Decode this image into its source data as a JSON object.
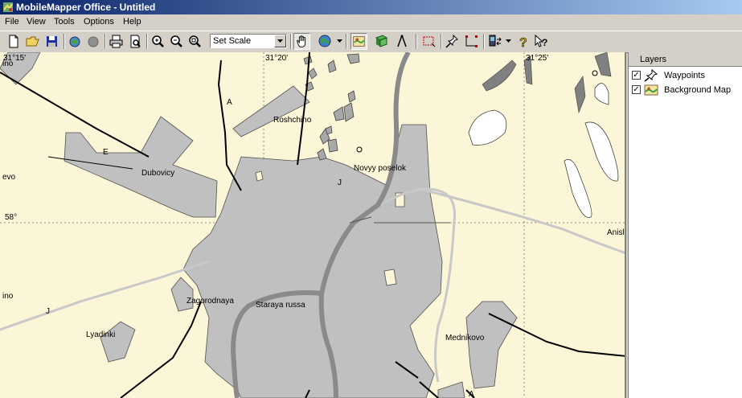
{
  "window": {
    "title": "MobileMapper Office - Untitled"
  },
  "menu": {
    "items": [
      "File",
      "View",
      "Tools",
      "Options",
      "Help"
    ]
  },
  "toolbar": {
    "scale_select": "Set Scale"
  },
  "map": {
    "coord_labels": [
      "31°15'",
      "31°20'",
      "31°25'",
      "58°"
    ],
    "edge_labels": [
      "ino",
      "ino",
      "Anisl",
      "evo"
    ],
    "road_labels": [
      "A",
      "E",
      "J",
      "J",
      "A"
    ],
    "places": [
      "Roshchino",
      "Dubovicy",
      "Novyy poselok",
      "Zagorodnaya",
      "Staraya russa",
      "Lyadinki",
      "Mednikovo"
    ],
    "colors": {
      "land": "#fbf6d7",
      "urban": "#c0c0c0",
      "highway": "#808080",
      "minor_road": "#c8c8c8",
      "line": "#000000"
    }
  },
  "layers": {
    "header": "Layers",
    "items": [
      {
        "name": "Waypoints",
        "checked": true,
        "icon": "pushpin-icon"
      },
      {
        "name": "Background Map",
        "checked": true,
        "icon": "map-icon"
      }
    ]
  }
}
